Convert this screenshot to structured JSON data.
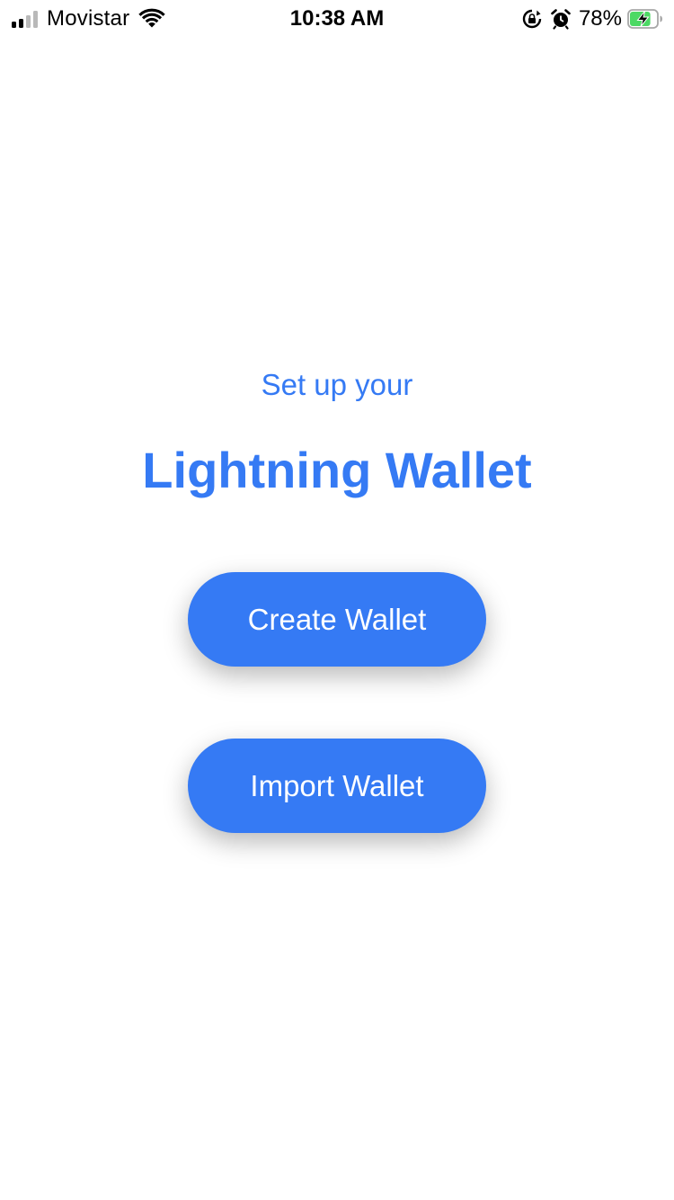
{
  "status_bar": {
    "carrier": "Movistar",
    "time": "10:38 AM",
    "battery_percent": "78%",
    "signal_bars_active": 2,
    "signal_bars_total": 4,
    "battery_level": 0.78,
    "battery_fill_color": "#4cd964",
    "icons": [
      "signal-icon",
      "wifi-icon",
      "orientation-lock-icon",
      "alarm-icon",
      "battery-charging-icon"
    ]
  },
  "onboarding": {
    "subtitle": "Set up your",
    "title": "Lightning Wallet",
    "create_button_label": "Create Wallet",
    "import_button_label": "Import Wallet"
  },
  "colors": {
    "accent": "#357af4",
    "background": "#ffffff",
    "button_text": "#ffffff"
  }
}
